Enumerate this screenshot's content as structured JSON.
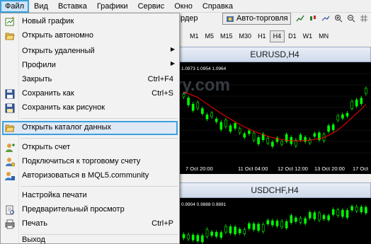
{
  "menubar": {
    "items": [
      "Файл",
      "Вид",
      "Вставка",
      "Графики",
      "Сервис",
      "Окно",
      "Справка"
    ]
  },
  "toolbar": {
    "order_partial": "рдер",
    "auto_trading": "Авто-торговля"
  },
  "timeframes": [
    "M1",
    "M5",
    "M15",
    "M30",
    "H1",
    "H4",
    "D1",
    "W1",
    "MN"
  ],
  "timeframe_selected": "H4",
  "file_menu": {
    "items": [
      {
        "label": "Новый график",
        "shortcut": "",
        "icon": "new-chart-icon"
      },
      {
        "label": "Открыть автономно",
        "shortcut": "",
        "icon": "open-folder-icon"
      },
      {
        "label": "Открыть удаленный",
        "shortcut": "",
        "submenu": true
      },
      {
        "label": "Профили",
        "shortcut": "",
        "submenu": true
      },
      {
        "label": "Закрыть",
        "shortcut": "Ctrl+F4"
      },
      {
        "label": "Сохранить как",
        "shortcut": "Ctrl+S",
        "icon": "save-icon"
      },
      {
        "label": "Сохранить как рисунок",
        "shortcut": "",
        "icon": "save-picture-icon"
      },
      {
        "label": "Открыть каталог данных",
        "shortcut": "",
        "icon": "folder-icon",
        "highlighted": true
      },
      {
        "label": "Открыть счет",
        "shortcut": "",
        "icon": "user-add-icon"
      },
      {
        "label": "Подключиться к торговому счету",
        "shortcut": "",
        "icon": "user-connect-icon"
      },
      {
        "label": "Авторизоваться в MQL5.community",
        "shortcut": "",
        "icon": "mql5-icon"
      },
      {
        "label": "Настройка печати",
        "shortcut": ""
      },
      {
        "label": "Предварительный просмотр",
        "shortcut": "",
        "icon": "print-preview-icon"
      },
      {
        "label": "Печать",
        "shortcut": "Ctrl+P",
        "icon": "printer-icon"
      },
      {
        "label": "Выход",
        "shortcut": ""
      }
    ]
  },
  "charts": [
    {
      "title": "EURUSD,H4",
      "ohlc": "1.0973 1.0954 1.0964",
      "time_labels": [
        "7 Oct 20:00",
        "11 Oct 04:00",
        "12 Oct 12:00",
        "13 Oct 20:00",
        "17 Oct"
      ]
    },
    {
      "title": "USDCHF,H4",
      "ohlc": "0.9904 0.9888 0.9891"
    }
  ],
  "watermark": "Binary.com",
  "colors": {
    "menu_highlight_border": "#3aa0dc",
    "candle": "#00ff00",
    "moving_average": "#ff0000",
    "chart_bg": "#000000"
  }
}
